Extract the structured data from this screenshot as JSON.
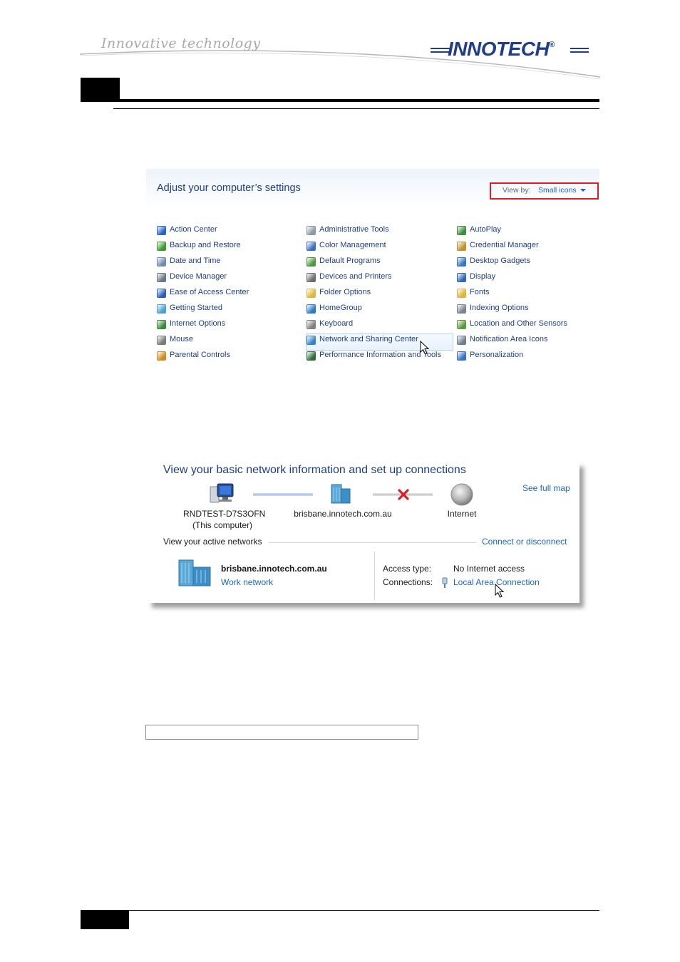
{
  "header": {
    "tagline": "Innovative technology",
    "brand": "INNOTECH",
    "brand_mark": "®"
  },
  "control_panel": {
    "title": "Adjust your computer’s settings",
    "view_by_label": "View by:",
    "view_by_value": "Small icons",
    "columns": [
      [
        {
          "label": "Action Center",
          "icon": "flag-icon",
          "color": "#2b62c8"
        },
        {
          "label": "Backup and Restore",
          "icon": "backup-icon",
          "color": "#3c9a2e"
        },
        {
          "label": "Date and Time",
          "icon": "clock-icon",
          "color": "#6f8bb3"
        },
        {
          "label": "Device Manager",
          "icon": "device-manager-icon",
          "color": "#6b7682"
        },
        {
          "label": "Ease of Access Center",
          "icon": "ease-of-access-icon",
          "color": "#2a5fb8"
        },
        {
          "label": "Getting Started",
          "icon": "getting-started-icon",
          "color": "#4a9fd4"
        },
        {
          "label": "Internet Options",
          "icon": "internet-options-icon",
          "color": "#3d8a3a"
        },
        {
          "label": "Mouse",
          "icon": "mouse-icon",
          "color": "#7a7a7a"
        },
        {
          "label": "Parental Controls",
          "icon": "parental-controls-icon",
          "color": "#d08a20"
        }
      ],
      [
        {
          "label": "Administrative Tools",
          "icon": "admin-tools-icon",
          "color": "#8a9aa8"
        },
        {
          "label": "Color Management",
          "icon": "color-management-icon",
          "color": "#3a6fc2"
        },
        {
          "label": "Default Programs",
          "icon": "default-programs-icon",
          "color": "#4c9a3c"
        },
        {
          "label": "Devices and Printers",
          "icon": "printer-icon",
          "color": "#6d6d6d"
        },
        {
          "label": "Folder Options",
          "icon": "folder-icon",
          "color": "#e0b53c"
        },
        {
          "label": "HomeGroup",
          "icon": "homegroup-icon",
          "color": "#2e7ac4"
        },
        {
          "label": "Keyboard",
          "icon": "keyboard-icon",
          "color": "#808080"
        },
        {
          "label": "Network and Sharing Center",
          "icon": "network-icon",
          "color": "#3a82c8"
        },
        {
          "label": "Performance Information and Tools",
          "icon": "performance-icon",
          "color": "#2d6f3a"
        }
      ],
      [
        {
          "label": "AutoPlay",
          "icon": "autoplay-icon",
          "color": "#3c8e3a"
        },
        {
          "label": "Credential Manager",
          "icon": "credential-icon",
          "color": "#c0902a"
        },
        {
          "label": "Desktop Gadgets",
          "icon": "gadgets-icon",
          "color": "#3575c4"
        },
        {
          "label": "Display",
          "icon": "display-icon",
          "color": "#2f67b8"
        },
        {
          "label": "Fonts",
          "icon": "fonts-icon",
          "color": "#e2b23a"
        },
        {
          "label": "Indexing Options",
          "icon": "indexing-icon",
          "color": "#7a8490"
        },
        {
          "label": "Location and Other Sensors",
          "icon": "sensors-icon",
          "color": "#5a9a3a"
        },
        {
          "label": "Notification Area Icons",
          "icon": "notification-icon",
          "color": "#6f7f8f"
        },
        {
          "label": "Personalization",
          "icon": "personalization-icon",
          "color": "#3a6fc8"
        }
      ]
    ]
  },
  "network": {
    "title": "View your basic network information and set up connections",
    "see_full_map": "See full map",
    "computer_name": "RNDTEST-D7S3OFN",
    "computer_sub": "(This computer)",
    "domain_name": "brisbane.innotech.com.au",
    "internet": "Internet",
    "active_label": "View your active networks",
    "connect_link": "Connect or disconnect",
    "network_name": "brisbane.innotech.com.au",
    "network_type": "Work network",
    "access_type_label": "Access type:",
    "access_type_value": "No Internet access",
    "connections_label": "Connections:",
    "connections_value": "Local Area Connection"
  }
}
